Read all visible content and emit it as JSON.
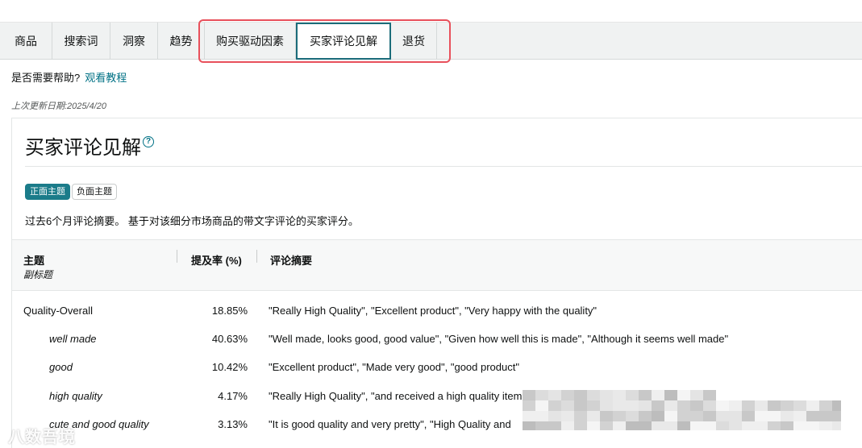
{
  "tabs": [
    {
      "label": "商品",
      "active": false
    },
    {
      "label": "搜索词",
      "active": false
    },
    {
      "label": "洞察",
      "active": false
    },
    {
      "label": "趋势",
      "active": false
    },
    {
      "label": "购买驱动因素",
      "active": false
    },
    {
      "label": "买家评论见解",
      "active": true
    },
    {
      "label": "退货",
      "active": false
    }
  ],
  "help": {
    "question": "是否需要帮助?",
    "link": "观看教程"
  },
  "updated": "上次更新日期:2025/4/20",
  "card": {
    "title": "买家评论见解",
    "info_icon": "?",
    "pills": {
      "positive": "正面主题",
      "negative": "负面主题"
    },
    "description": "过去6个月评论摘要。 基于对该细分市场商品的带文字评论的买家评分。"
  },
  "table": {
    "headers": {
      "topic": "主题",
      "subtopic": "副标题",
      "rate": "提及率 (%)",
      "summary": "评论摘要"
    },
    "rows": [
      {
        "topic": "Quality-Overall",
        "rate": "18.85%",
        "summary": "\"Really High Quality\", \"Excellent product\", \"Very happy with the quality\"",
        "sub": false
      },
      {
        "topic": "well made",
        "rate": "40.63%",
        "summary": "\"Well made, looks good, good value\", \"Given how well this is made\", \"Although it seems well made\"",
        "sub": true
      },
      {
        "topic": "good",
        "rate": "10.42%",
        "summary": "\"Excellent product\", \"Made very good\", \"good product\"",
        "sub": true
      },
      {
        "topic": "high quality",
        "rate": "4.17%",
        "summary": "\"Really High Quality\", \"and received a high quality item\", \"As described - high quality\"",
        "sub": true
      },
      {
        "topic": "cute and good quality",
        "rate": "3.13%",
        "summary": "\"It is good quality and very pretty\", \"High Quality and",
        "sub": true
      }
    ]
  },
  "watermark": "八数吾境"
}
